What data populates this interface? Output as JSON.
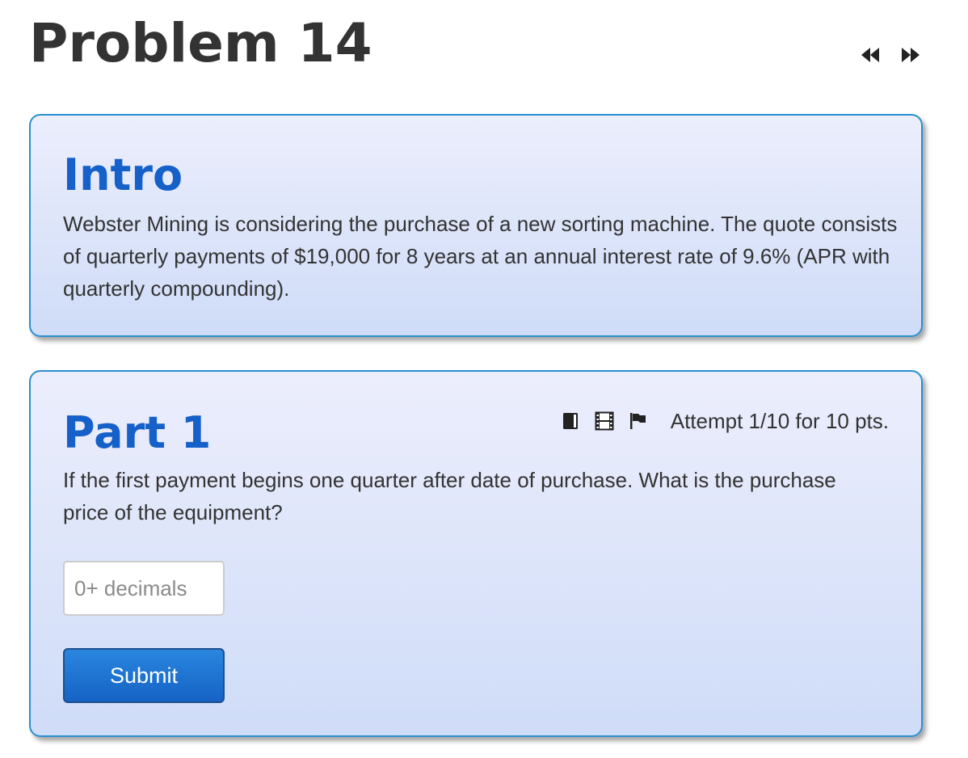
{
  "page": {
    "title": "Problem 14"
  },
  "nav": {
    "prev_icon": "double-left-arrow",
    "next_icon": "double-right-arrow"
  },
  "intro": {
    "heading": "Intro",
    "text": "Webster Mining is considering the purchase of a new sorting machine. The quote consists of quarterly payments of $19,000 for 8 years at an annual interest rate of 9.6% (APR with quarterly compounding)."
  },
  "part1": {
    "heading": "Part 1",
    "icons": [
      "book-icon",
      "film-icon",
      "flag-icon"
    ],
    "attempt": "Attempt 1/10 for 10 pts.",
    "question": "If the first payment begins one quarter after date of purchase. What is the purchase price of the equipment?",
    "input": {
      "value": "",
      "placeholder": "0+ decimals"
    },
    "submit_label": "Submit"
  },
  "colors": {
    "heading_blue": "#1560c9",
    "card_border": "#2a8fd0",
    "button_blue": "#1563c5"
  }
}
